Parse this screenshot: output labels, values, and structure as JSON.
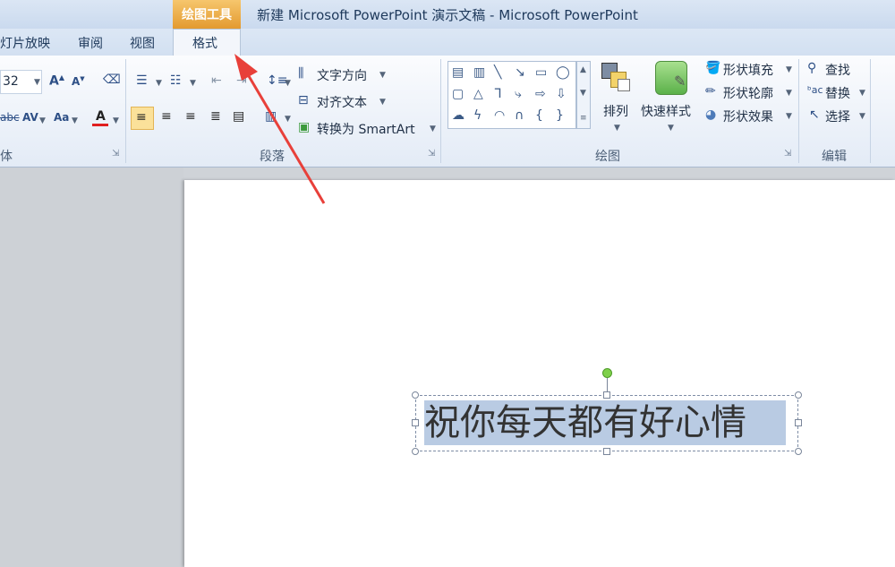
{
  "window": {
    "title": "新建 Microsoft PowerPoint 演示文稿 - Microsoft PowerPoint"
  },
  "tool_tab_group": "绘图工具",
  "tabs": [
    "灯片放映",
    "审阅",
    "视图",
    "格式"
  ],
  "font": {
    "size": "32",
    "group_label": "体"
  },
  "paragraph": {
    "text_direction": "文字方向",
    "align_text": "对齐文本",
    "convert_smartart": "转换为 SmartArt",
    "group_label": "段落"
  },
  "drawing": {
    "arrange": "排列",
    "quick_styles": "快速样式",
    "shape_fill": "形状填充",
    "shape_outline": "形状轮廓",
    "shape_effects": "形状效果",
    "group_label": "绘图"
  },
  "editing": {
    "find": "查找",
    "replace": "替换",
    "select": "选择",
    "group_label": "编辑"
  },
  "slide": {
    "text": "祝你每天都有好心情"
  },
  "colors": {
    "annotation_arrow": "#e8403a",
    "accent_tab": "#e39a2f",
    "selection": "#b9cbe3"
  }
}
